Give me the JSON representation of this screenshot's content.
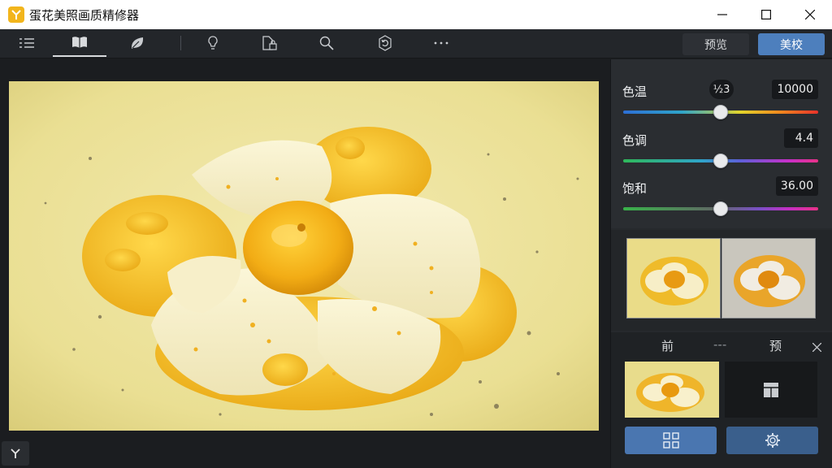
{
  "window": {
    "title": "蛋花美照画质精修器",
    "minimize_icon": "minimize-icon",
    "maximize_icon": "maximize-icon",
    "close_icon": "close-icon"
  },
  "toolbar": {
    "tools": [
      {
        "name": "list-icon",
        "active": false
      },
      {
        "name": "book-icon",
        "active": true
      },
      {
        "name": "leaf-icon",
        "active": false
      },
      {
        "name": "bulb-icon",
        "active": false
      },
      {
        "name": "file-lock-icon",
        "active": false
      },
      {
        "name": "search-icon",
        "active": false
      },
      {
        "name": "refresh-icon",
        "active": false
      },
      {
        "name": "more-icon",
        "active": false
      }
    ],
    "preview_label": "预览",
    "beauty_label": "美校"
  },
  "adjustments": [
    {
      "label": "色温",
      "chip": "½3",
      "value": "10000",
      "level": 0.5,
      "track": "warm"
    },
    {
      "label": "色调",
      "value": "4.4",
      "level": 0.5,
      "track": "tint"
    },
    {
      "label": "饱和",
      "value": "36.00",
      "level": 0.5,
      "track": "sat"
    }
  ],
  "bottom_panel": {
    "left_label": "前",
    "middle_label": "---",
    "right_label": "预",
    "close_icon": "close-icon",
    "empty_icon": "layout-icon",
    "left_button_icon": "grid-icon",
    "right_button_icon": "gear-icon"
  },
  "colors": {
    "accent": "#4d7fbd",
    "button_blue": "#4a76b0",
    "app_icon": "#f2b51c"
  }
}
